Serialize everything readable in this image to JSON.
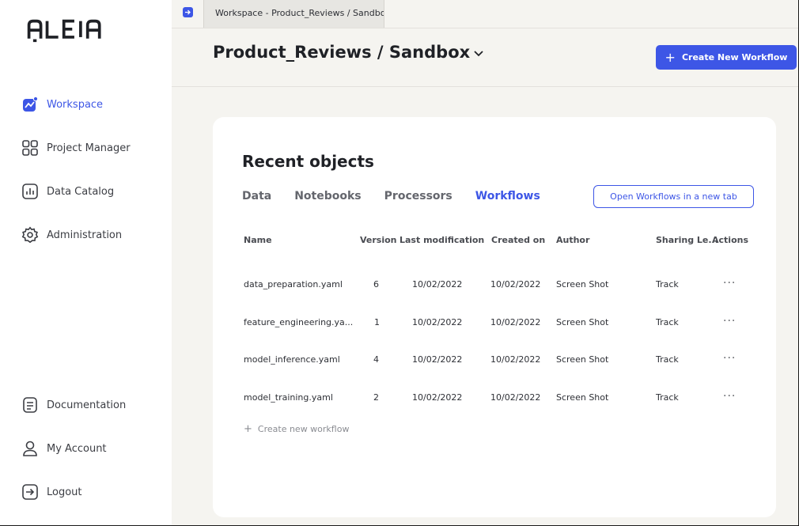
{
  "app": {
    "logo_text": "ALEIA"
  },
  "sidebar": {
    "items": [
      {
        "label": "Workspace",
        "icon": "workspace-icon",
        "active": true
      },
      {
        "label": "Project Manager",
        "icon": "grid-icon"
      },
      {
        "label": "Data Catalog",
        "icon": "chart-icon"
      },
      {
        "label": "Administration",
        "icon": "gear-icon"
      }
    ],
    "bottom_items": [
      {
        "label": "Documentation",
        "icon": "document-icon"
      },
      {
        "label": "My Account",
        "icon": "user-icon"
      },
      {
        "label": "Logout",
        "icon": "logout-icon"
      }
    ]
  },
  "tabbar": {
    "active_tab": "Workspace - Product_Reviews / Sandbox"
  },
  "header": {
    "title": "Product_Reviews / Sandbox",
    "create_button": "Create New Workflow"
  },
  "card": {
    "title": "Recent objects",
    "tabs": [
      "Data",
      "Notebooks",
      "Processors",
      "Workflows"
    ],
    "active_tab": "Workflows",
    "open_button": "Open Workflows in a new tab",
    "columns": [
      "Name",
      "Version",
      "Last modification",
      "Created on",
      "Author",
      "Sharing Le...",
      "Actions"
    ],
    "rows": [
      {
        "name": "data_preparation.yaml",
        "version": "6",
        "modified": "10/02/2022",
        "created": "10/02/2022",
        "author": "Screen Shot",
        "sharing": "Track",
        "actions": "···"
      },
      {
        "name": "feature_engineering.ya...",
        "version": "1",
        "modified": "10/02/2022",
        "created": "10/02/2022",
        "author": "Screen Shot",
        "sharing": "Track",
        "actions": "···"
      },
      {
        "name": "model_inference.yaml",
        "version": "4",
        "modified": "10/02/2022",
        "created": "10/02/2022",
        "author": "Screen Shot",
        "sharing": "Track",
        "actions": "···"
      },
      {
        "name": "model_training.yaml",
        "version": "2",
        "modified": "10/02/2022",
        "created": "10/02/2022",
        "author": "Screen Shot",
        "sharing": "Track",
        "actions": "···"
      }
    ],
    "create_link": "Create new workflow"
  },
  "colors": {
    "accent": "#3d56e6",
    "background": "#f5f4f0"
  }
}
